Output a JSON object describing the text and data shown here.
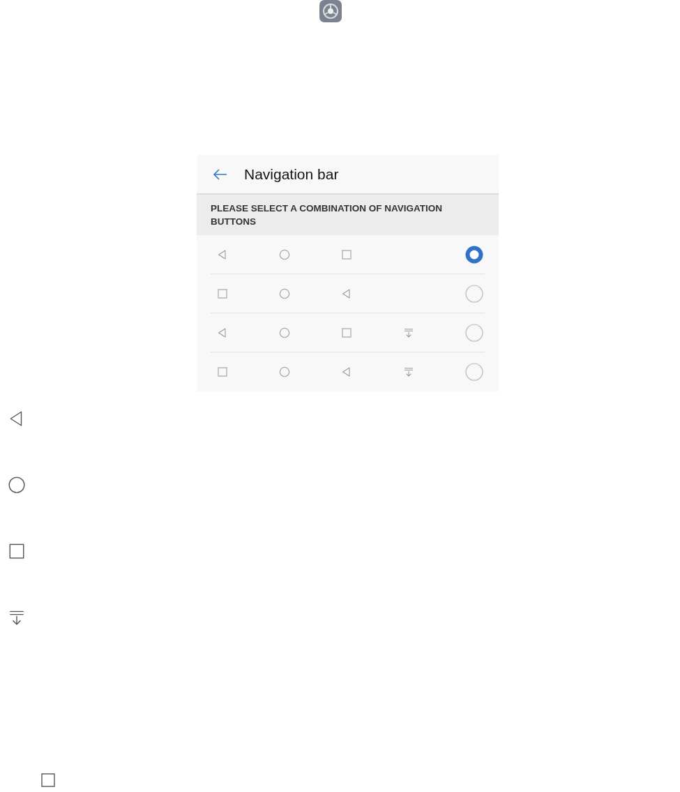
{
  "screen": {
    "title": "Navigation bar",
    "section_header": "PLEASE SELECT A COMBINATION OF NAVIGATION BUTTONS",
    "combinations": [
      {
        "buttons": [
          {
            "kind": "back"
          },
          {
            "kind": "home"
          },
          {
            "kind": "recent"
          }
        ],
        "selected": true
      },
      {
        "buttons": [
          {
            "kind": "recent"
          },
          {
            "kind": "home"
          },
          {
            "kind": "back"
          }
        ],
        "selected": false
      },
      {
        "buttons": [
          {
            "kind": "back"
          },
          {
            "kind": "home"
          },
          {
            "kind": "recent"
          },
          {
            "kind": "notification"
          }
        ],
        "selected": false
      },
      {
        "buttons": [
          {
            "kind": "recent"
          },
          {
            "kind": "home"
          },
          {
            "kind": "back"
          },
          {
            "kind": "notification"
          }
        ],
        "selected": false
      }
    ]
  },
  "legend_icons": [
    {
      "kind": "back"
    },
    {
      "kind": "home"
    },
    {
      "kind": "recent"
    },
    {
      "kind": "notification"
    }
  ],
  "footer_icon": {
    "kind": "recent"
  }
}
